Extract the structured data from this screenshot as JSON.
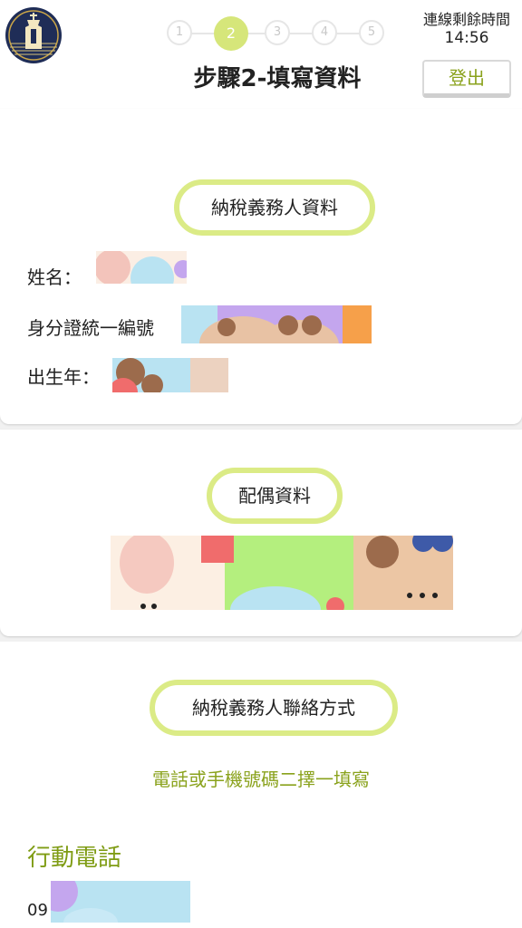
{
  "header": {
    "steps": [
      "1",
      "2",
      "3",
      "4",
      "5"
    ],
    "active_step": 2,
    "title": "步驟2-填寫資料",
    "timer_label": "連線剩餘時間",
    "timer_value": "14:56",
    "logout_label": "登出"
  },
  "taxpayer": {
    "section_title": "納稅義務人資料",
    "name_label": "姓名：",
    "id_label": "身分證統一編號",
    "birth_label": "出生年："
  },
  "spouse": {
    "section_title": "配偶資料"
  },
  "contact": {
    "section_title": "納稅義務人聯絡方式",
    "hint": "電話或手機號碼二擇一填寫",
    "mobile_heading": "行動電話",
    "mobile_prefix": "09"
  },
  "colors": {
    "accent_green": "#8aa21c",
    "pill_border": "#dbeb86",
    "active_step": "#d6e67a"
  }
}
